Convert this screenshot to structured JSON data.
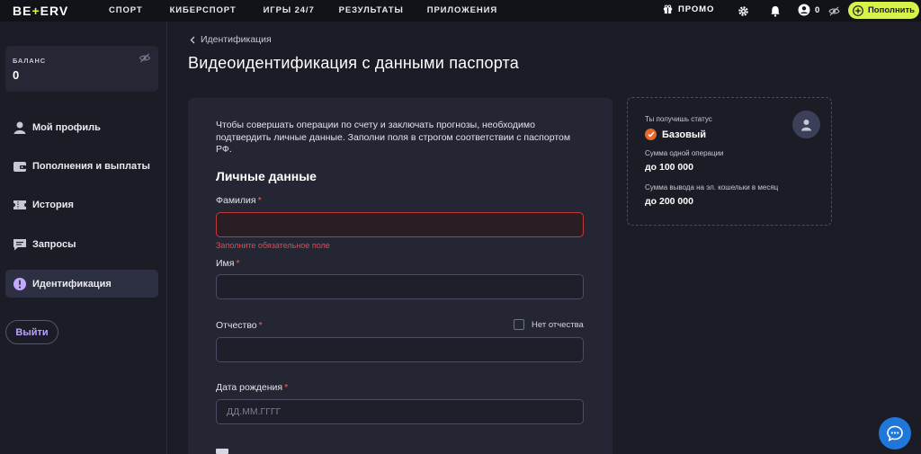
{
  "header": {
    "logo_left": "BE",
    "logo_plus": "+",
    "logo_right": "ERV",
    "nav": [
      {
        "label": "СПОРТ"
      },
      {
        "label": "КИБЕРСПОРТ"
      },
      {
        "label": "ИГРЫ 24/7"
      },
      {
        "label": "РЕЗУЛЬТАТЫ"
      },
      {
        "label": "ПРИЛОЖЕНИЯ"
      }
    ],
    "promo_label": "ПРОМО",
    "account_balance": "0",
    "deposit_label": "Пополнить",
    "accent_color": "#d7f24a"
  },
  "sidebar": {
    "balance_label": "БАЛАНС",
    "balance_value": "0",
    "items": [
      {
        "label": "Мой профиль",
        "icon": "user-icon"
      },
      {
        "label": "Пополнения и выплаты",
        "icon": "wallet-icon"
      },
      {
        "label": "История",
        "icon": "ticket-icon"
      },
      {
        "label": "Запросы",
        "icon": "chat-icon"
      },
      {
        "label": "Идентификация",
        "icon": "alert-icon",
        "active": true
      }
    ],
    "logout_label": "Выйти"
  },
  "main": {
    "breadcrumb": "Идентификация",
    "title": "Видеоидентификация с данными паспорта",
    "intro": "Чтобы совершать операции по счету и заключать прогнозы, необходимо подтвердить личные данные. Заполни поля в строгом соответствии с паспортом РФ.",
    "section_title": "Личные данные",
    "fields": {
      "surname": {
        "label": "Фамилия",
        "required": "*",
        "value": "",
        "error": "Заполните обязательное поле"
      },
      "name": {
        "label": "Имя",
        "required": "*",
        "value": ""
      },
      "patronymic": {
        "label": "Отчество",
        "required": "*",
        "value": "",
        "no_patronymic_label": "Нет отчества"
      },
      "birthdate": {
        "label": "Дата рождения",
        "required": "*",
        "value": "",
        "placeholder": "ДД.ММ.ГГГГ"
      }
    }
  },
  "status": {
    "label": "Ты получишь статус",
    "level": "Базовый",
    "op_label": "Сумма одной операции",
    "op_value": "до 100 000",
    "wallet_label": "Сумма вывода на эл. кошельки в месяц",
    "wallet_value": "до 200 000",
    "check_color": "#e8672b"
  },
  "colors": {
    "background": "#1b1c25",
    "card": "#252633",
    "error": "#e5484d",
    "link_purple": "#b8a3ff",
    "chat_blue": "#1f78d9"
  }
}
